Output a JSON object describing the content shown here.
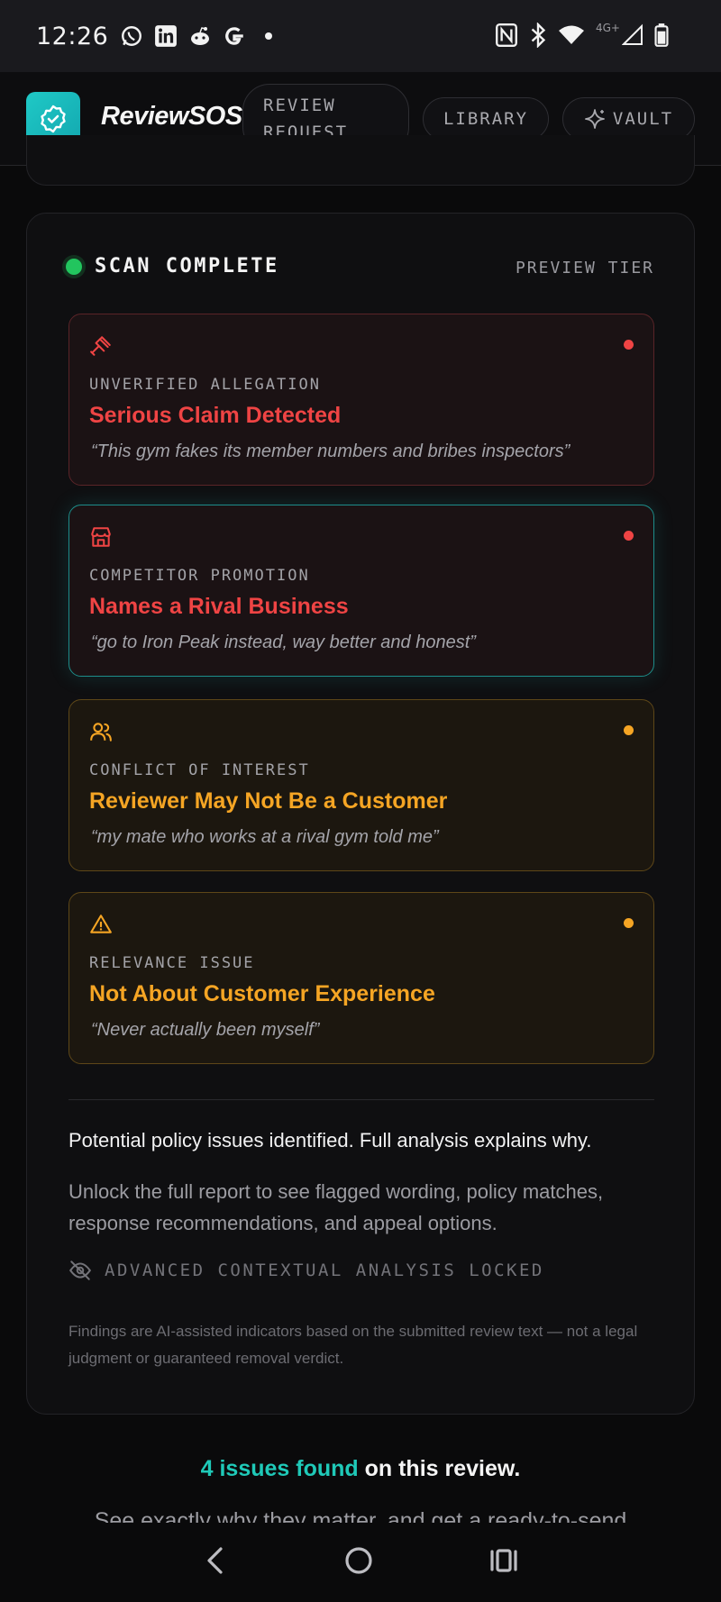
{
  "status_bar": {
    "time": "12:26",
    "network_label": "4G+",
    "icons_left": [
      "whatsapp-icon",
      "linkedin-icon",
      "reddit-icon",
      "google-icon",
      "dot-icon"
    ],
    "icons_right": [
      "nfc-icon",
      "bluetooth-icon",
      "wifi-icon",
      "signal-icon",
      "battery-icon"
    ]
  },
  "app_bar": {
    "brand": "ReviewSOS",
    "nav": {
      "review_request": "REVIEW REQUEST",
      "library": "LIBRARY",
      "vault": "VAULT"
    }
  },
  "scan": {
    "status": "SCAN COMPLETE",
    "tier": "PREVIEW TIER",
    "status_color": "#22c55e"
  },
  "issues": [
    {
      "icon": "gavel-icon",
      "category": "UNVERIFIED ALLEGATION",
      "title": "Serious Claim Detected",
      "quote": "“This gym fakes its member numbers and bribes inspectors”",
      "severity": "red"
    },
    {
      "icon": "storefront-icon",
      "category": "COMPETITOR PROMOTION",
      "title": "Names a Rival Business",
      "quote": "“go to Iron Peak instead, way better and honest”",
      "severity": "red"
    },
    {
      "icon": "users-icon",
      "category": "CONFLICT OF INTEREST",
      "title": "Reviewer May Not Be a Customer",
      "quote": "“my mate who works at a rival gym told me”",
      "severity": "amber"
    },
    {
      "icon": "warning-icon",
      "category": "RELEVANCE ISSUE",
      "title": "Not About Customer Experience",
      "quote": "“Never actually been myself”",
      "severity": "amber"
    }
  ],
  "summary": {
    "headline": "Potential policy issues identified. Full analysis explains why.",
    "unlock_text": "Unlock the full report to see flagged wording, policy matches, response recommendations, and appeal options.",
    "locked_label": "ADVANCED CONTEXTUAL ANALYSIS LOCKED",
    "disclaimer": "Findings are AI-assisted indicators based on the submitted review text — not a legal judgment or guaranteed removal verdict."
  },
  "cta": {
    "count_text": "4 issues found",
    "rest_text": " on this review.",
    "subtext": "See exactly why they matter, and get a ready-to-send"
  },
  "colors": {
    "accent": "#1fc9b8",
    "red": "#ef4444",
    "amber": "#f5a524"
  }
}
